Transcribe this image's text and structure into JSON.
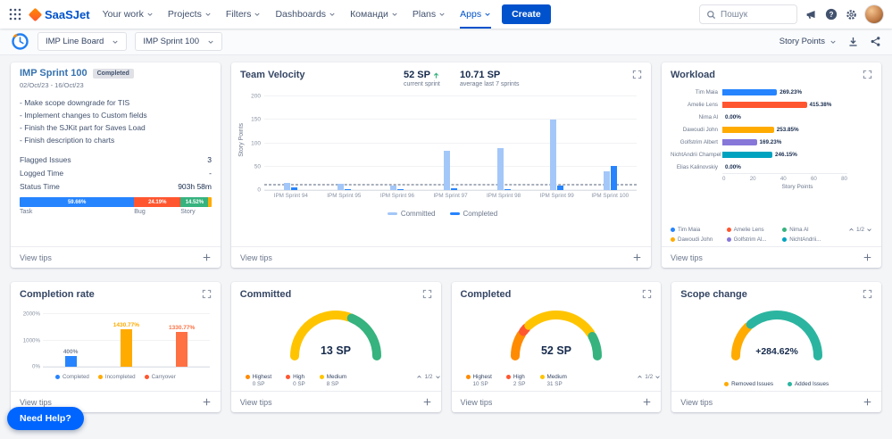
{
  "icons": {
    "question": "?"
  },
  "strings": {
    "view_tips": "View tips",
    "need_help": "Need Help?"
  },
  "navbar": {
    "logo": "SaaSJet",
    "items": [
      {
        "label": "Your work",
        "active": false
      },
      {
        "label": "Projects",
        "active": false
      },
      {
        "label": "Filters",
        "active": false
      },
      {
        "label": "Dashboards",
        "active": false
      },
      {
        "label": "Команди",
        "active": false
      },
      {
        "label": "Plans",
        "active": false
      },
      {
        "label": "Apps",
        "active": true
      }
    ],
    "create": "Create",
    "search_placeholder": "Пошук"
  },
  "toolbar": {
    "board": "IMP Line Board",
    "sprint": "IMP Sprint 100",
    "metric": "Story Points"
  },
  "sprint_card": {
    "title": "IMP Sprint 100",
    "badge": "Completed",
    "dates": "02/Oct/23 - 16/Oct/23",
    "goals": [
      "- Make scope downgrade for TIS",
      "- Implement changes to Custom fields",
      "- Finish the SJKit part for Saves Load",
      "- Finish description to charts"
    ],
    "stats": [
      {
        "label": "Flagged Issues",
        "value": "3"
      },
      {
        "label": "Logged Time",
        "value": "-"
      },
      {
        "label": "Status Time",
        "value": "903h 58m"
      }
    ]
  },
  "chart_data": [
    {
      "id": "velocity",
      "type": "bar",
      "title": "Team Velocity",
      "current": {
        "value": "52 SP",
        "label": "current sprint",
        "trend": "up"
      },
      "average": {
        "value": "10.71 SP",
        "label": "average last 7 sprints"
      },
      "categories": [
        "IPM Sprint 94",
        "IPM Sprint 95",
        "IPM Sprint 96",
        "IPM Sprint 97",
        "IPM Sprint 98",
        "IPM Sprint 99",
        "IPM Sprint 100"
      ],
      "series": [
        {
          "name": "Committed",
          "color": "#a3c7f8",
          "values": [
            15,
            13,
            10,
            84,
            90,
            150,
            40
          ]
        },
        {
          "name": "Completed",
          "color": "#2684ff",
          "values": [
            5,
            2,
            1,
            3,
            2,
            10,
            52
          ]
        }
      ],
      "ylabel": "Story Points",
      "ylim": [
        0,
        200
      ],
      "yticks": [
        0,
        50,
        100,
        150,
        200
      ],
      "average_line": 10.71,
      "legend_position": "bottom"
    },
    {
      "id": "workload",
      "type": "bar-horizontal",
      "title": "Workload",
      "categories": [
        "Tim Maia",
        "Amelie Lens",
        "Nima Al",
        "Dawoudi John",
        "Golfstrim Albert",
        "NichtAndrii Champel",
        "Elias Kalinovskiy"
      ],
      "values": [
        35,
        54,
        0,
        33,
        22,
        32,
        0
      ],
      "value_labels": [
        "269.23%",
        "415.38%",
        "0.00%",
        "253.85%",
        "169.23%",
        "246.15%",
        "0.00%"
      ],
      "colors": [
        "#2684ff",
        "#ff5630",
        "#36b37e",
        "#ffab00",
        "#8777d9",
        "#00a3bf",
        "#6b778c"
      ],
      "xlabel": "Story Points",
      "xlim": [
        0,
        80
      ],
      "xticks": [
        0,
        20,
        40,
        60,
        80
      ],
      "legend": [
        {
          "label": "Tim Maia",
          "color": "#2684ff"
        },
        {
          "label": "Amelie Lens",
          "color": "#ff5630"
        },
        {
          "label": "Nima Al",
          "color": "#36b37e"
        },
        {
          "label": "Dawoudi John",
          "color": "#ffab00"
        },
        {
          "label": "Golfstrim Al...",
          "color": "#8777d9"
        },
        {
          "label": "NichtAndrii...",
          "color": "#00a3bf"
        }
      ],
      "pagination": "1/2"
    },
    {
      "id": "completion_rate",
      "type": "bar",
      "title": "Completion rate",
      "categories": [
        "Completed",
        "Incompleted",
        "Carryover"
      ],
      "values": [
        400,
        1430.77,
        1330.77
      ],
      "value_labels": [
        "400%",
        "1430.77%",
        "1330.77%"
      ],
      "colors": [
        "#2684ff",
        "#ffab00",
        "#ff7043"
      ],
      "value_label_colors": [
        "#7a869a",
        "#ffab00",
        "#ff7043"
      ],
      "ylim": [
        0,
        2000
      ],
      "yticks": [
        {
          "value": 0,
          "label": "0%"
        },
        {
          "value": 1000,
          "label": "1000%"
        },
        {
          "value": 2000,
          "label": "2000%"
        }
      ],
      "legend": [
        {
          "label": "Completed",
          "color": "#2684ff"
        },
        {
          "label": "Incompleted",
          "color": "#ffab00"
        },
        {
          "label": "Carryover",
          "color": "#ff5630"
        }
      ]
    },
    {
      "id": "committed",
      "type": "gauge",
      "title": "Committed",
      "center": "13 SP",
      "segments": [
        {
          "color": "#ffc400",
          "value": 8
        },
        {
          "color": "#36b37e",
          "value": 5
        }
      ],
      "legend": [
        {
          "label": "Highest",
          "value": "0 SP",
          "color": "#ff8b00"
        },
        {
          "label": "High",
          "value": "0 SP",
          "color": "#ff5630"
        },
        {
          "label": "Medium",
          "value": "8 SP",
          "color": "#ffc400"
        }
      ],
      "pagination": "1/2"
    },
    {
      "id": "completed",
      "type": "gauge",
      "title": "Completed",
      "center": "52 SP",
      "segments": [
        {
          "color": "#ff8b00",
          "value": 10
        },
        {
          "color": "#ff5630",
          "value": 2
        },
        {
          "color": "#ffc400",
          "value": 31
        },
        {
          "color": "#36b37e",
          "value": 9
        }
      ],
      "legend": [
        {
          "label": "Highest",
          "value": "10 SP",
          "color": "#ff8b00"
        },
        {
          "label": "High",
          "value": "2 SP",
          "color": "#ff5630"
        },
        {
          "label": "Medium",
          "value": "31 SP",
          "color": "#ffc400"
        }
      ],
      "pagination": "1/2"
    },
    {
      "id": "scope_change",
      "type": "gauge",
      "title": "Scope change",
      "center": "+284.62%",
      "segments": [
        {
          "color": "#ffab00",
          "value": 13
        },
        {
          "color": "#2bb5a0",
          "value": 37
        }
      ],
      "legend": [
        {
          "label": "Removed Issues",
          "color": "#ffab00"
        },
        {
          "label": "Added Issues",
          "color": "#2bb5a0"
        }
      ]
    },
    {
      "id": "issue_distribution",
      "type": "stacked-bar",
      "segments": [
        {
          "label": "Task",
          "pct": "59.66%",
          "value": 59.66,
          "color": "#2684ff"
        },
        {
          "label": "Bug",
          "pct": "24.19%",
          "value": 24.19,
          "color": "#ff5630"
        },
        {
          "label": "Story",
          "pct": "14.52%",
          "value": 14.52,
          "color": "#36b37e"
        },
        {
          "label": "",
          "pct": "",
          "value": 1.63,
          "color": "#ffab00"
        }
      ]
    }
  ]
}
